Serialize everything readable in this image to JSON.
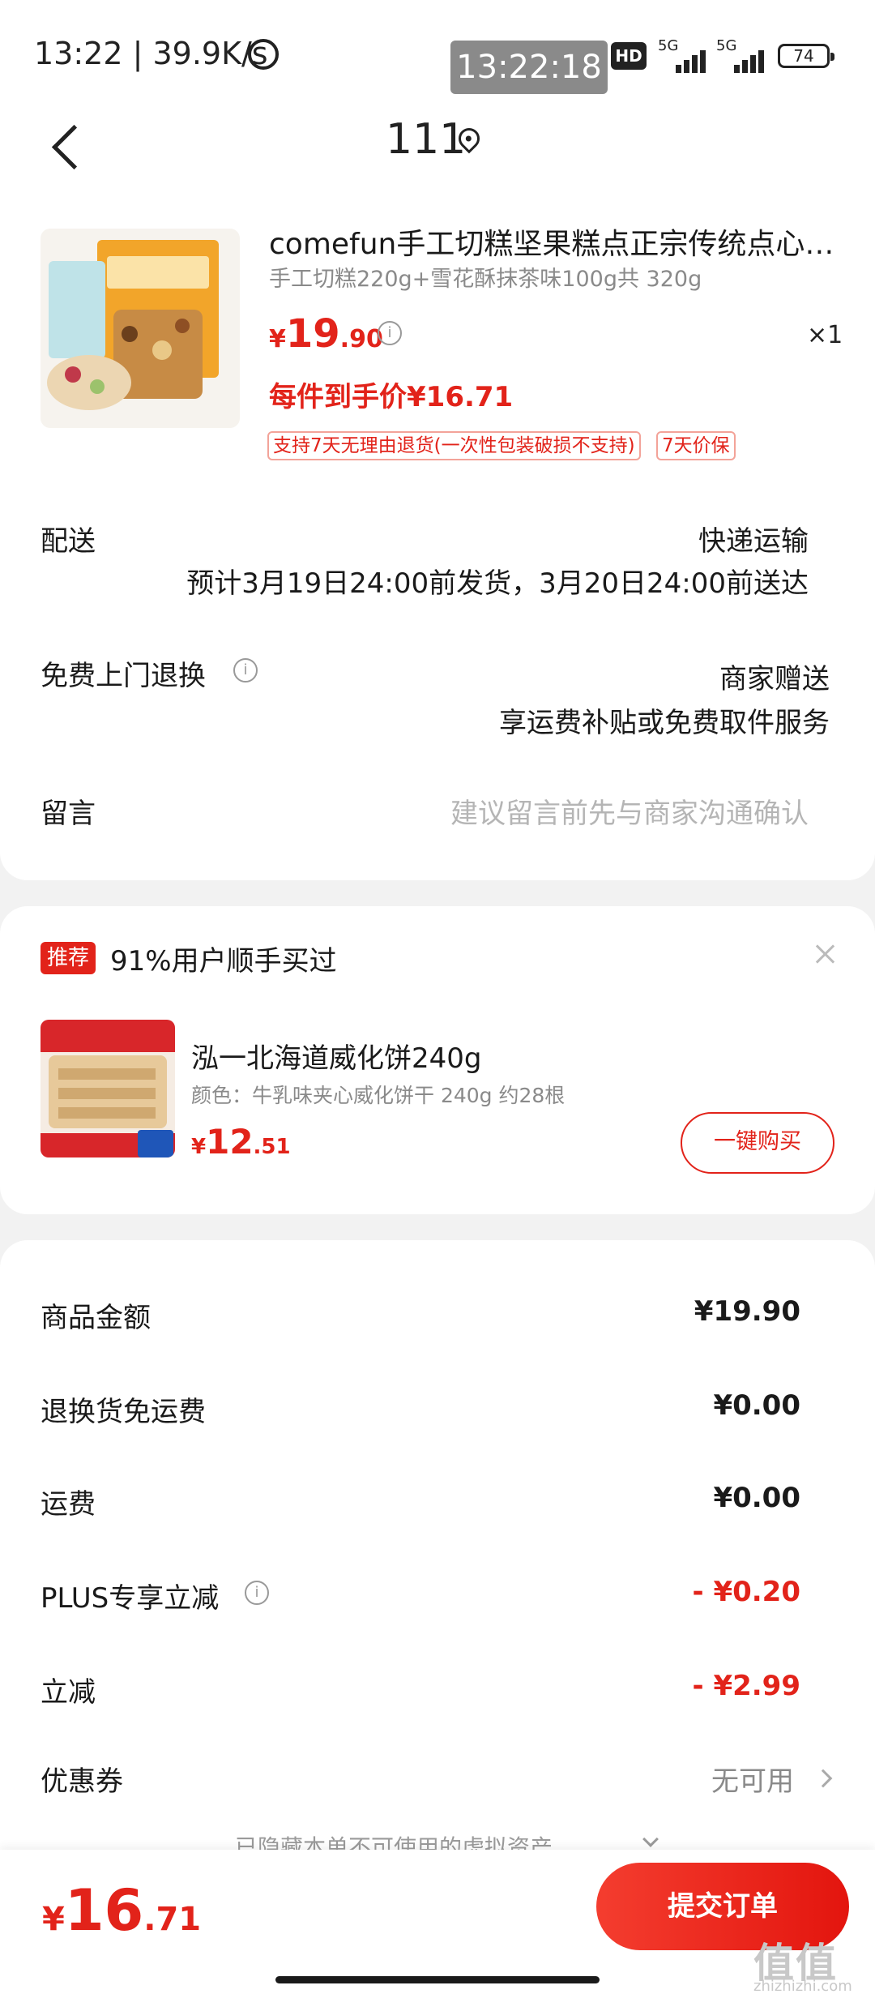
{
  "status_bar": {
    "time_speed": "13:22 | 39.9K/s",
    "overlay_time": "13:22:18",
    "hd_label": "HD",
    "network_1": "5G",
    "network_2": "5G",
    "battery": "74"
  },
  "header": {
    "title": "111"
  },
  "product": {
    "title": "comefun手工切糕坚果糕点正宗传统点心…",
    "spec": "手工切糕220g+雪花酥抹茶味100g共 320g",
    "price_symbol": "¥",
    "price_int": "19",
    "price_dec": ".90",
    "quantity": "×1",
    "final_price_label": "每件到手价¥16.71",
    "tags": [
      "支持7天无理由退货(一次性包装破损不支持)",
      "7天价保"
    ]
  },
  "delivery": {
    "label": "配送",
    "method": "快递运输",
    "estimate": "预计3月19日24:00前发货，3月20日24:00前送达"
  },
  "returns": {
    "label": "免费上门退换",
    "value": "商家赠送",
    "detail": "享运费补贴或免费取件服务"
  },
  "message": {
    "label": "留言",
    "placeholder": "建议留言前先与商家沟通确认"
  },
  "recommendation": {
    "badge": "推荐",
    "title": "91%用户顺手买过",
    "name": "泓一北海道威化饼240g",
    "spec": "颜色：牛乳味夹心威化饼干 240g 约28根",
    "price_symbol": "¥",
    "price_int": "12",
    "price_dec": ".51",
    "buy_label": "一键购买"
  },
  "summary": {
    "rows": [
      {
        "label": "商品金额",
        "value": "¥19.90"
      },
      {
        "label": "退换货免运费",
        "value": "¥0.00"
      },
      {
        "label": "运费",
        "value": "¥0.00"
      },
      {
        "label": "PLUS专享立减",
        "value": "- ¥0.20"
      },
      {
        "label": "立减",
        "value": "- ¥2.99"
      },
      {
        "label": "优惠券",
        "value": "无可用"
      }
    ],
    "hidden_note": "已隐藏本单不可使用的虚拟资产"
  },
  "footer": {
    "total_symbol": "¥",
    "total_int": "16",
    "total_dec": ".71",
    "submit_label": "提交订单",
    "watermark": "值值值",
    "watermark_sub": "zhizhizhi.com"
  },
  "colors": {
    "accent": "#e2231a",
    "background": "#f2f2f2",
    "card": "#ffffff"
  },
  "icons": [
    "back-icon",
    "location-icon",
    "info-icon",
    "close-icon",
    "chevron-right-icon",
    "chevron-down-icon"
  ]
}
